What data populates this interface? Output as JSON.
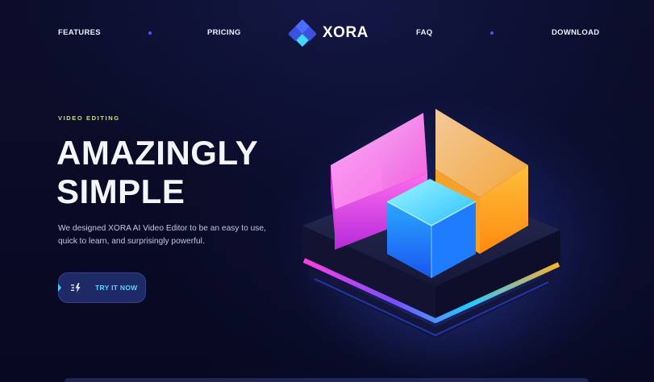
{
  "nav": {
    "left": [
      "FEATURES",
      "PRICING"
    ],
    "right": [
      "FAQ",
      "DOWNLOAD"
    ],
    "brand": "XORA",
    "accent": "#3b5cff"
  },
  "hero": {
    "eyebrow": "VIDEO EDITING",
    "headline_line1": "AMAZINGLY",
    "headline_line2": "SIMPLE",
    "description": "We designed XORA AI Video Editor to be an easy to use, quick to learn, and surprisingly powerful.",
    "cta_label": "TRY IT NOW",
    "cta_icon": "bolt-icon"
  },
  "colors": {
    "background": "#080a22",
    "eyebrow": "#c8e07a",
    "cta_bg": "#1e2a66",
    "cta_text": "#58d6ff"
  }
}
